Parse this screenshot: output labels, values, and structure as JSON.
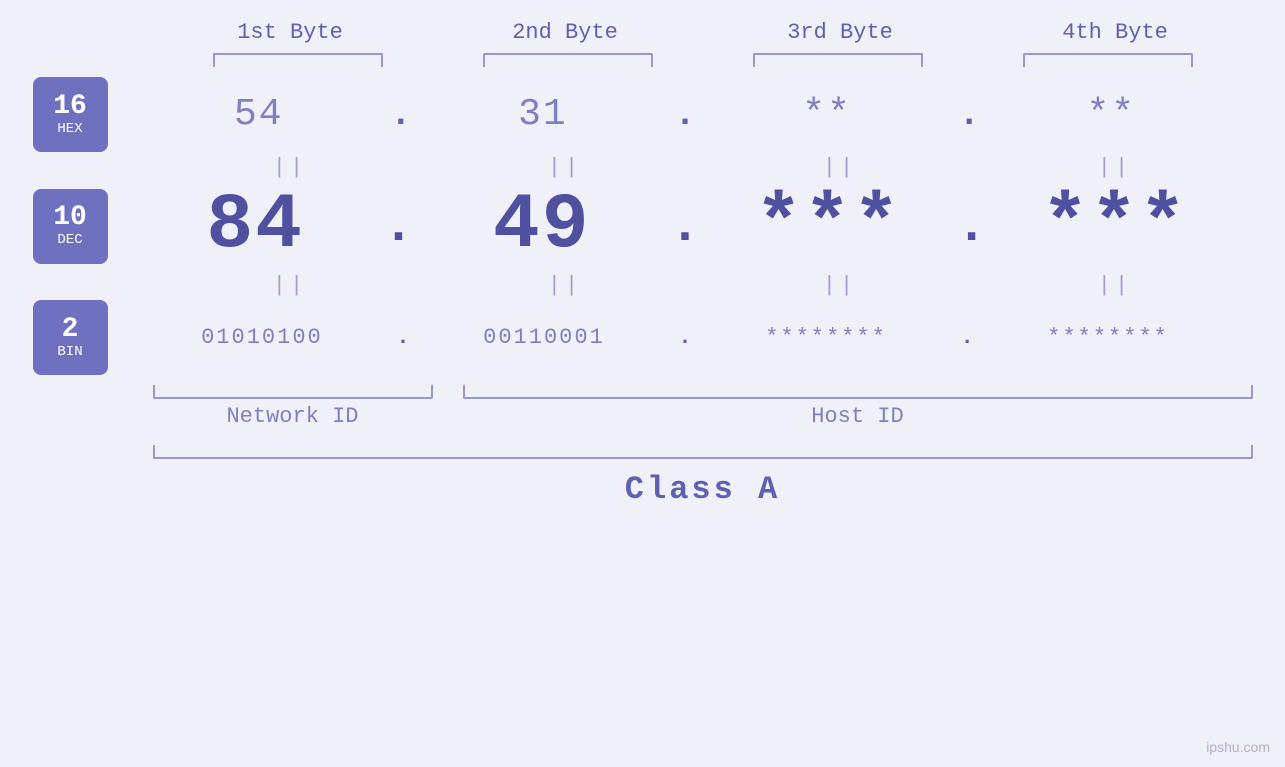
{
  "header": {
    "byte_labels": [
      "1st Byte",
      "2nd Byte",
      "3rd Byte",
      "4th Byte"
    ]
  },
  "badges": [
    {
      "base": "16",
      "label": "HEX"
    },
    {
      "base": "10",
      "label": "DEC"
    },
    {
      "base": "2",
      "label": "BIN"
    }
  ],
  "rows": {
    "hex": {
      "values": [
        "54",
        "31",
        "**",
        "**"
      ],
      "dots": [
        ".",
        ".",
        ".",
        ""
      ]
    },
    "dec": {
      "values": [
        "84",
        "49",
        "***",
        "***"
      ],
      "dots": [
        ".",
        ".",
        ".",
        ""
      ]
    },
    "bin": {
      "values": [
        "01010100",
        "00110001",
        "********",
        "********"
      ],
      "dots": [
        ".",
        ".",
        ".",
        ""
      ]
    }
  },
  "labels": {
    "network_id": "Network ID",
    "host_id": "Host ID",
    "class": "Class A"
  },
  "watermark": "ipshu.com"
}
